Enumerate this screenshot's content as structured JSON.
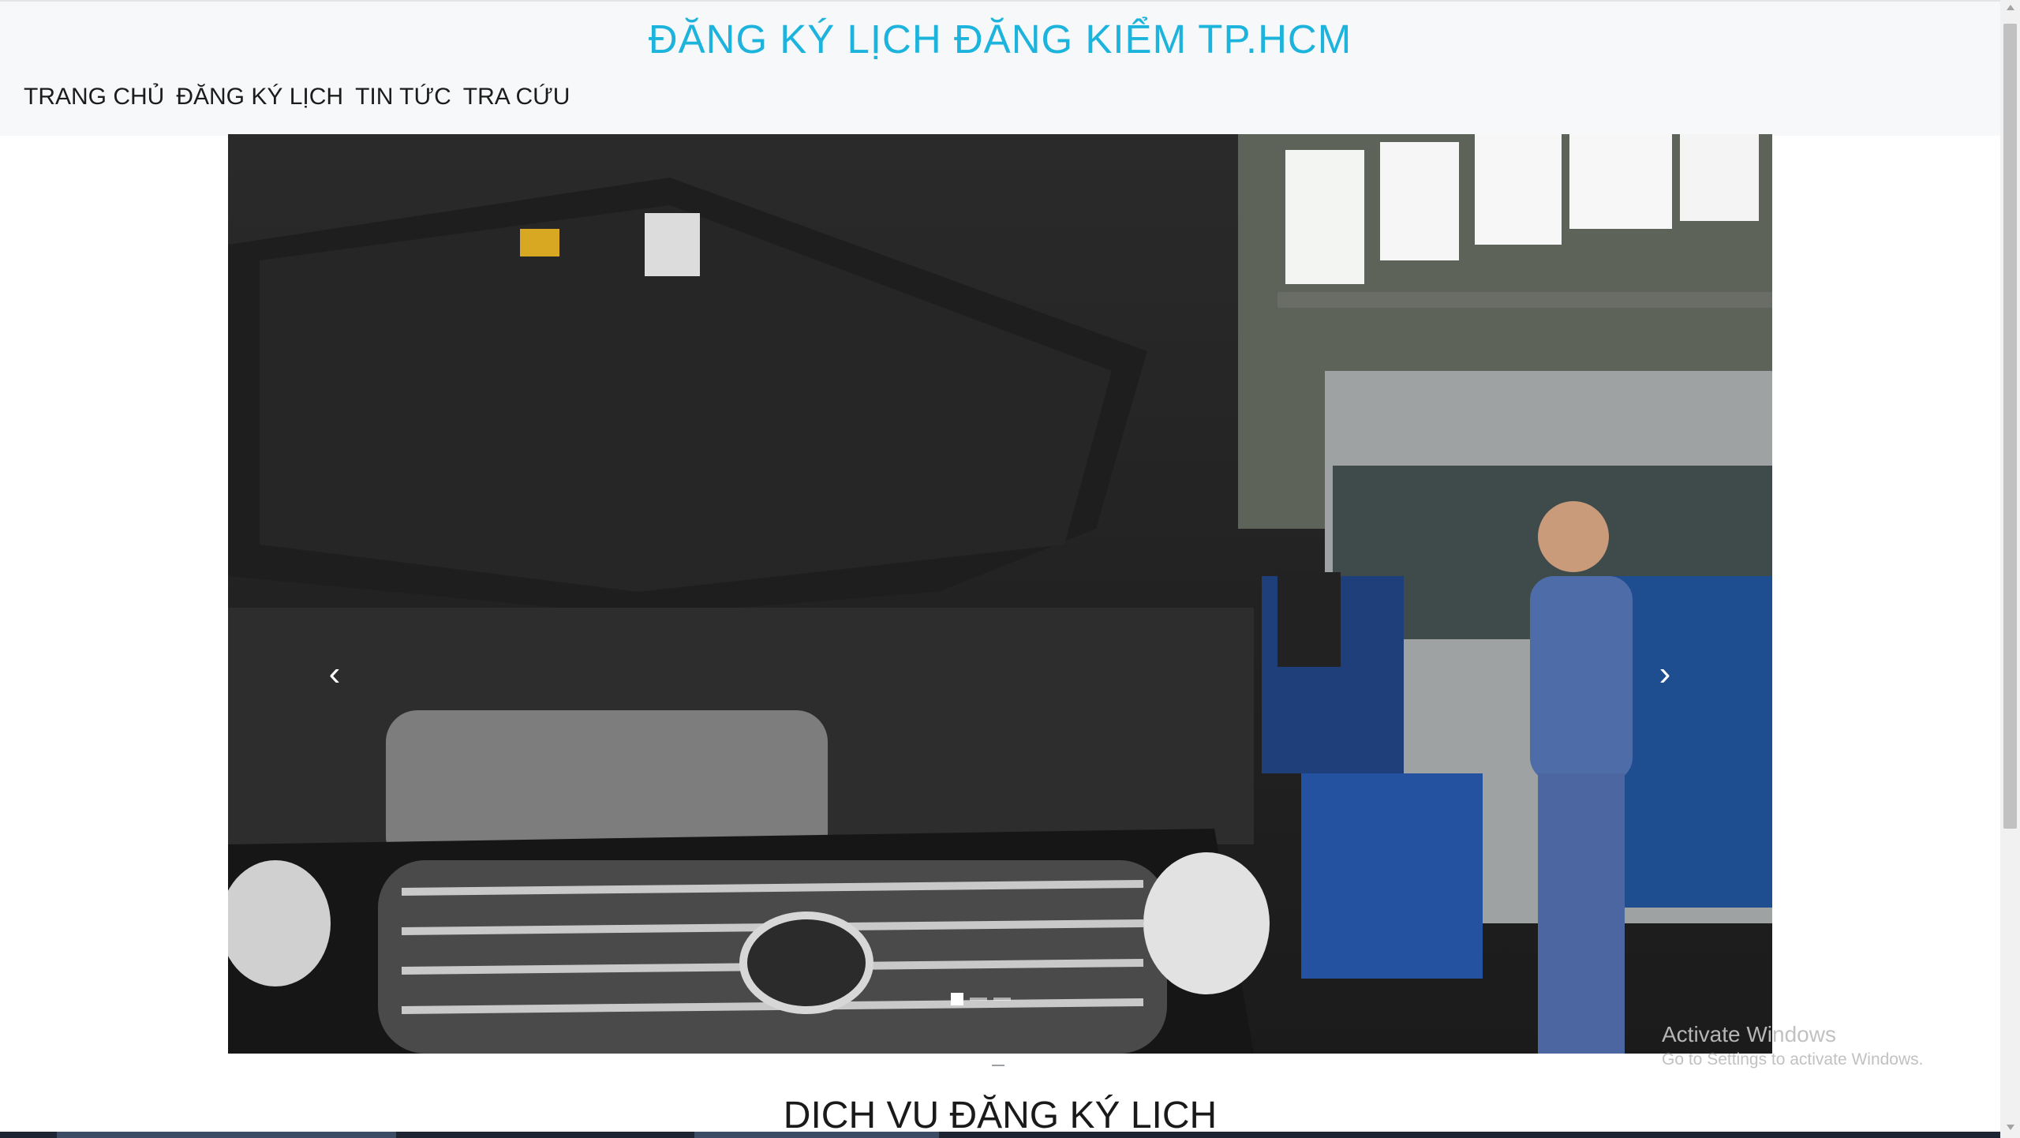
{
  "site": {
    "title": "ĐĂNG KÝ LỊCH ĐĂNG KIỂM TP.HCM"
  },
  "nav": {
    "items": [
      {
        "label": "TRANG CHỦ"
      },
      {
        "label": "ĐĂNG KÝ LỊCH"
      },
      {
        "label": "TIN TỨC"
      },
      {
        "label": "TRA CỨU"
      }
    ]
  },
  "carousel": {
    "prev_icon": "‹",
    "next_icon": "›",
    "slides_count": 3,
    "active_index": 0
  },
  "section": {
    "title": "DICH VU ĐĂNG KÝ LICH"
  },
  "watermark": {
    "title": "Activate Windows",
    "subtitle": "Go to Settings to activate Windows."
  },
  "colors": {
    "title": "#1cb3dd",
    "header_bg": "#f7f8f9"
  }
}
